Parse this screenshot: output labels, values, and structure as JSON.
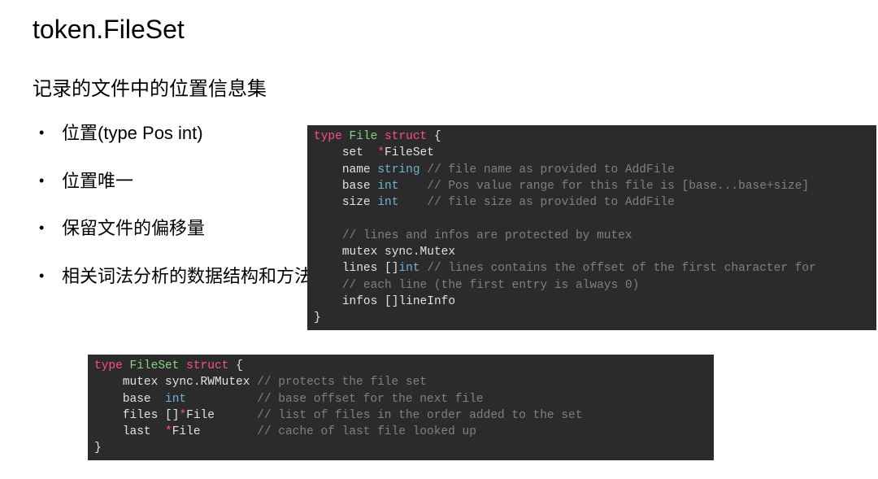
{
  "title": "token.FileSet",
  "subtitle": "记录的文件中的位置信息集",
  "bullets": [
    "位置(type Pos int)",
    "位置唯一",
    "保留文件的偏移量",
    "相关词法分析的数据结构和方法"
  ],
  "code1": {
    "kw_type": "type",
    "name": "File",
    "kw_struct": "struct",
    "brace_open": "{",
    "f_set": "set",
    "op_star1": "*",
    "t_fileset": "FileSet",
    "f_name": "name",
    "t_string": "string",
    "c_name": "// file name as provided to AddFile",
    "f_base": "base",
    "t_int1": "int",
    "c_base": "// Pos value range for this file is [base...base+size]",
    "f_size": "size",
    "t_int2": "int",
    "c_size": "// file size as provided to AddFile",
    "c_sec": "// lines and infos are protected by mutex",
    "f_mutex": "mutex",
    "t_mutex": "sync.Mutex",
    "f_lines": "lines",
    "br_lines": "[]",
    "t_int3": "int",
    "c_lines1": "// lines contains the offset of the first character for",
    "c_lines2": "// each line (the first entry is always 0)",
    "f_infos": "infos",
    "br_infos": "[]",
    "t_lineinfo": "lineInfo",
    "brace_close": "}"
  },
  "code2": {
    "kw_type": "type",
    "name": "FileSet",
    "kw_struct": "struct",
    "brace_open": "{",
    "f_mutex": "mutex",
    "t_mutex": "sync.RWMutex",
    "c_mutex": "// protects the file set",
    "f_base": "base",
    "t_int": "int",
    "c_base": "// base offset for the next file",
    "f_files": "files",
    "br_files": "[]",
    "op_star1": "*",
    "t_file1": "File",
    "c_files": "// list of files in the order added to the set",
    "f_last": "last",
    "op_star2": "*",
    "t_file2": "File",
    "c_last": "// cache of last file looked up",
    "brace_close": "}"
  }
}
